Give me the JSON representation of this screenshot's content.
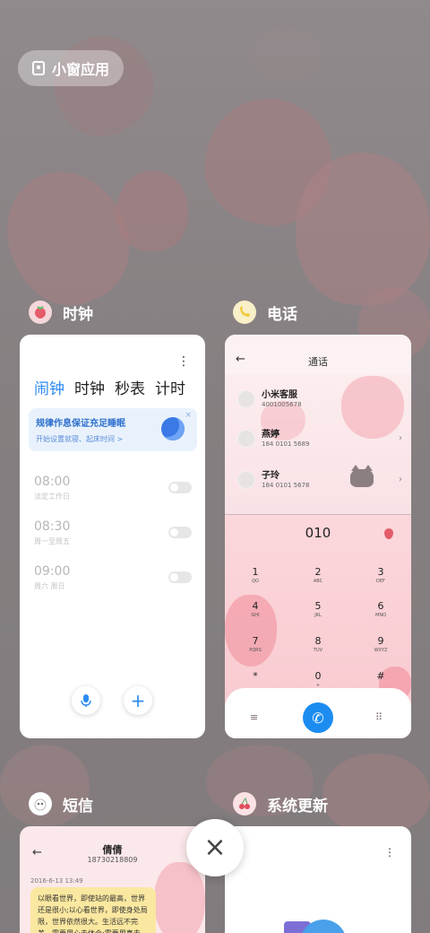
{
  "top_pill": {
    "label": "小窗应用",
    "icon": "small-window-icon"
  },
  "apps": {
    "clock": {
      "name": "时钟",
      "icon": "strawberry-clock-icon"
    },
    "phone": {
      "name": "电话",
      "icon": "banana-phone-icon"
    },
    "sms": {
      "name": "短信",
      "icon": "cloud-sms-icon"
    },
    "update": {
      "name": "系统更新",
      "icon": "cherry-update-icon"
    }
  },
  "clock_card": {
    "menu": "⋮",
    "tabs": [
      "闹钟",
      "时钟",
      "秒表",
      "计时"
    ],
    "active_tab": "闹钟",
    "banner": {
      "title": "规律作息保证充足睡眠",
      "subtitle": "开始设置就寝、起床时间 >",
      "close": "×"
    },
    "alarms": [
      {
        "time": "08:00",
        "label": "法定工作日"
      },
      {
        "time": "08:30",
        "label": "周一至周五"
      },
      {
        "time": "09:00",
        "label": "周六 周日"
      }
    ],
    "mic_icon": "microphone-icon",
    "add_label": "+"
  },
  "phone_card": {
    "back": "←",
    "title": "通话",
    "contacts": [
      {
        "name": "小米客服",
        "number": "4001005678"
      },
      {
        "name": "燕婷",
        "number": "184 0101 5689"
      },
      {
        "name": "子玲",
        "number": "184 0101 5678"
      }
    ],
    "dialed": "010",
    "keys": [
      {
        "digit": "1",
        "letters": "QO"
      },
      {
        "digit": "2",
        "letters": "ABC"
      },
      {
        "digit": "3",
        "letters": "DEF"
      },
      {
        "digit": "4",
        "letters": "GHI"
      },
      {
        "digit": "5",
        "letters": "JKL"
      },
      {
        "digit": "6",
        "letters": "MNO"
      },
      {
        "digit": "7",
        "letters": "PQRS"
      },
      {
        "digit": "8",
        "letters": "TUV"
      },
      {
        "digit": "9",
        "letters": "WXYZ"
      },
      {
        "digit": "*",
        "letters": ""
      },
      {
        "digit": "0",
        "letters": "+"
      },
      {
        "digit": "#",
        "letters": ""
      }
    ],
    "left_icon": "≡",
    "right_icon": "⠿",
    "call_icon": "✆"
  },
  "sms_card": {
    "back": "←",
    "contact_name": "倩倩",
    "contact_number": "18730218809",
    "menu": "⋮",
    "date": "2016-6-13 13:49",
    "message": "以眼看世界，即使站的最高，世界还是很小;以心看世界，即使身处局限，世界依然很大。生活远不完美，需要用心去体会;需要用真去..."
  },
  "update_card": {
    "menu": "⋮"
  },
  "close_button": "×"
}
